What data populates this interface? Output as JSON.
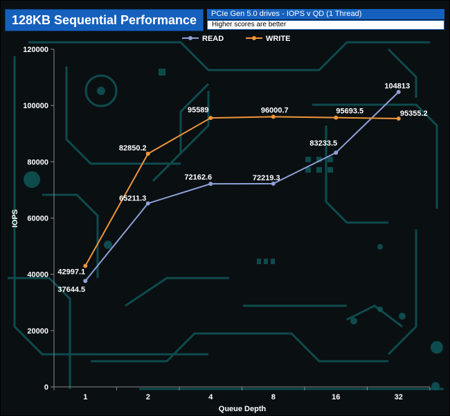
{
  "header": {
    "title": "128KB Sequential Performance",
    "subtitle": "PCIe Gen 5.0 drives - IOPS v QD (1 Thread)",
    "note": "Higher scores are better"
  },
  "colors": {
    "read": "#8fa0d8",
    "write": "#f0963a",
    "title_bg": "#1560bd",
    "circuit": "#0f5a5c",
    "background": "#0a0f12"
  },
  "chart_data": {
    "type": "line",
    "categories": [
      "1",
      "2",
      "4",
      "8",
      "16",
      "32"
    ],
    "series": [
      {
        "name": "READ",
        "values": [
          37644.5,
          65211.3,
          72162.6,
          72219.3,
          83233.5,
          104813
        ],
        "labels": [
          "37644.5",
          "65211.3",
          "72162.6",
          "72219.3",
          "83233.5",
          "104813"
        ]
      },
      {
        "name": "WRITE",
        "values": [
          42997.1,
          82850.2,
          95589,
          96000.7,
          95693.5,
          95355.2
        ],
        "labels": [
          "42997.1",
          "82850.2",
          "95589",
          "96000.7",
          "95693.5",
          "95355.2"
        ]
      }
    ],
    "xlabel": "Queue Depth",
    "ylabel": "IOPS",
    "ylim": [
      0,
      120000
    ],
    "yticks": [
      0,
      20000,
      40000,
      60000,
      80000,
      100000,
      120000
    ],
    "ytick_labels": [
      "0",
      "20000",
      "40000",
      "60000",
      "80000",
      "100000",
      "120000"
    ],
    "grid": false,
    "legend": "top-center"
  }
}
